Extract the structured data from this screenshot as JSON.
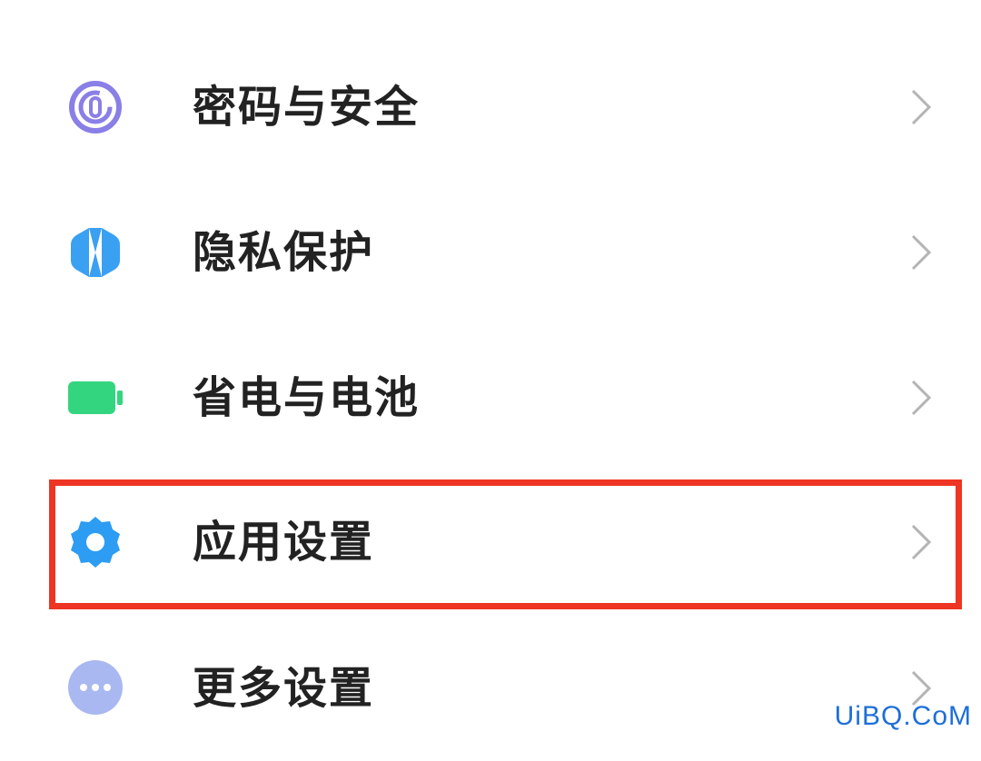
{
  "settings": {
    "items": [
      {
        "label": "密码与安全",
        "icon": "fingerprint-icon",
        "icon_color": "#8a7fe6"
      },
      {
        "label": "隐私保护",
        "icon": "shield-icon",
        "icon_color": "#3aa0f2"
      },
      {
        "label": "省电与电池",
        "icon": "battery-icon",
        "icon_color": "#34d57f"
      },
      {
        "label": "应用设置",
        "icon": "gear-icon",
        "icon_color": "#2d9cf3",
        "highlighted": true
      },
      {
        "label": "更多设置",
        "icon": "more-dots-icon",
        "icon_color": "#a9b8f0"
      }
    ]
  },
  "highlight": {
    "color": "#ee3423"
  },
  "watermark": {
    "text": "UiBQ.CoM"
  }
}
